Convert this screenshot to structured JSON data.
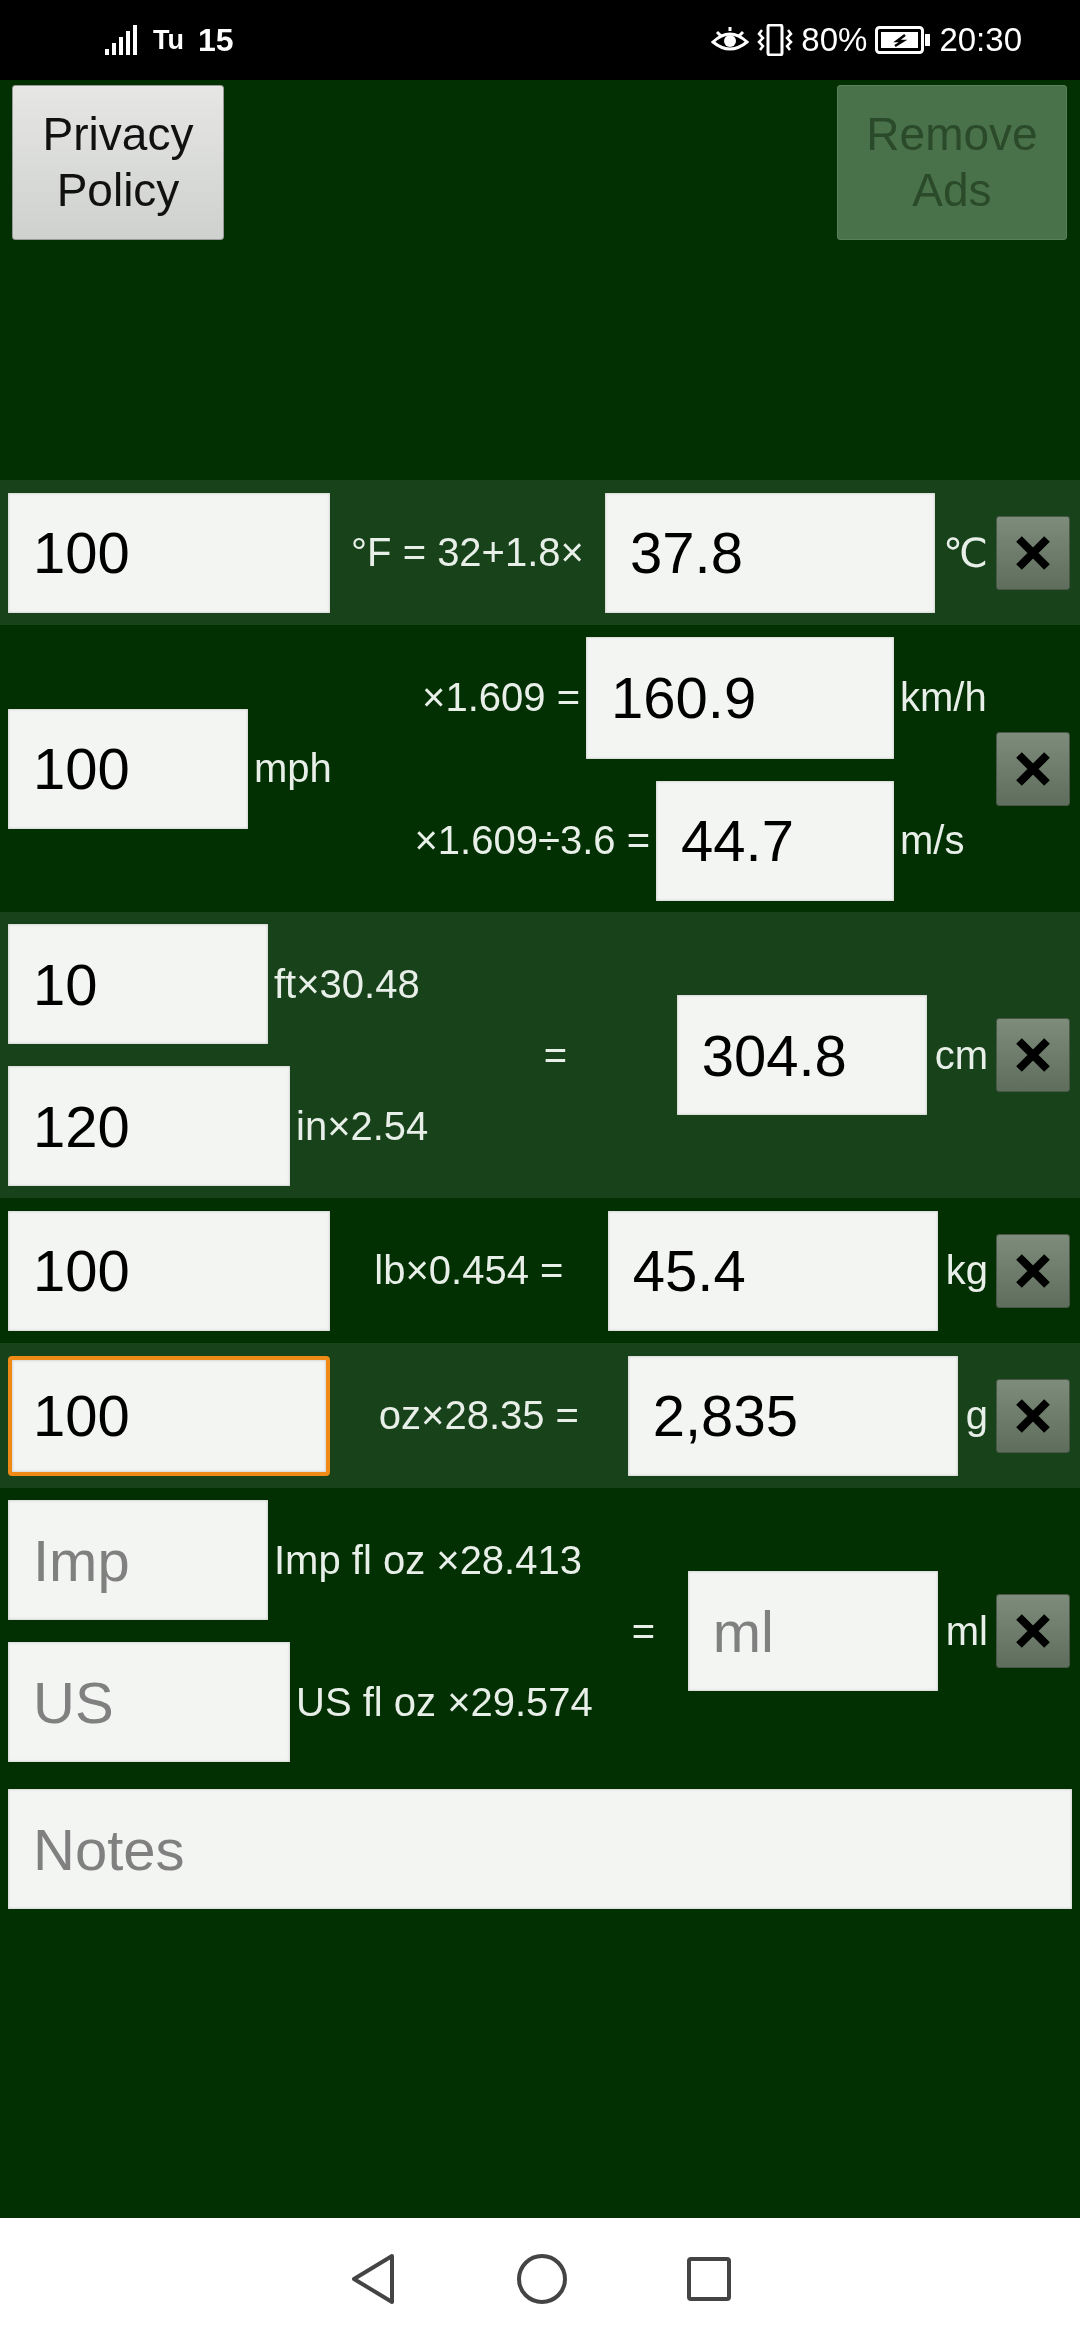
{
  "status_bar": {
    "carrier": "Tu",
    "network_number": "15",
    "battery_percent": "80%",
    "time": "20:30"
  },
  "top_buttons": [
    {
      "label": "Privacy Policy",
      "disabled": false
    },
    {
      "label": "Remove Ads",
      "disabled": true
    }
  ],
  "converters": [
    {
      "kind": "single",
      "input": {
        "value": "100",
        "focused": false
      },
      "formula": "°F = 32+1.8×",
      "output": {
        "value": "37.8",
        "focused": false
      },
      "unit": "℃"
    },
    {
      "kind": "split_output",
      "input": {
        "value": "100",
        "focused": false
      },
      "input_unit": "mph",
      "outputs": [
        {
          "formula": "×1.609 =",
          "field": {
            "value": "160.9",
            "focused": false
          },
          "unit": "km/h"
        },
        {
          "formula": "×1.609÷3.6 =",
          "field": {
            "value": "44.7",
            "focused": false
          },
          "unit": "m/s"
        }
      ]
    },
    {
      "kind": "split_input",
      "inputs": [
        {
          "field": {
            "value": "10",
            "focused": false
          },
          "formula": "ft×30.48"
        },
        {
          "field": {
            "value": "120",
            "focused": false
          },
          "formula": "in×2.54"
        }
      ],
      "equals": "=",
      "output": {
        "value": "304.8",
        "focused": false
      },
      "unit": "cm"
    },
    {
      "kind": "single",
      "input": {
        "value": "100",
        "focused": false
      },
      "formula": "lb×0.454 =",
      "output": {
        "value": "45.4",
        "focused": false
      },
      "unit": "kg"
    },
    {
      "kind": "single",
      "input": {
        "value": "100",
        "focused": true
      },
      "formula": "oz×28.35 =",
      "output": {
        "value": "2,835",
        "focused": false
      },
      "unit": "g"
    },
    {
      "kind": "split_input",
      "inputs": [
        {
          "field": {
            "placeholder": "Imp",
            "focused": false
          },
          "formula": "Imp fl oz ×28.413"
        },
        {
          "field": {
            "placeholder": "US",
            "focused": false
          },
          "formula": "US fl oz ×29.574"
        }
      ],
      "equals": "=",
      "output": {
        "placeholder": "ml",
        "focused": false
      },
      "unit": "ml"
    }
  ],
  "notes": {
    "placeholder": "Notes"
  }
}
